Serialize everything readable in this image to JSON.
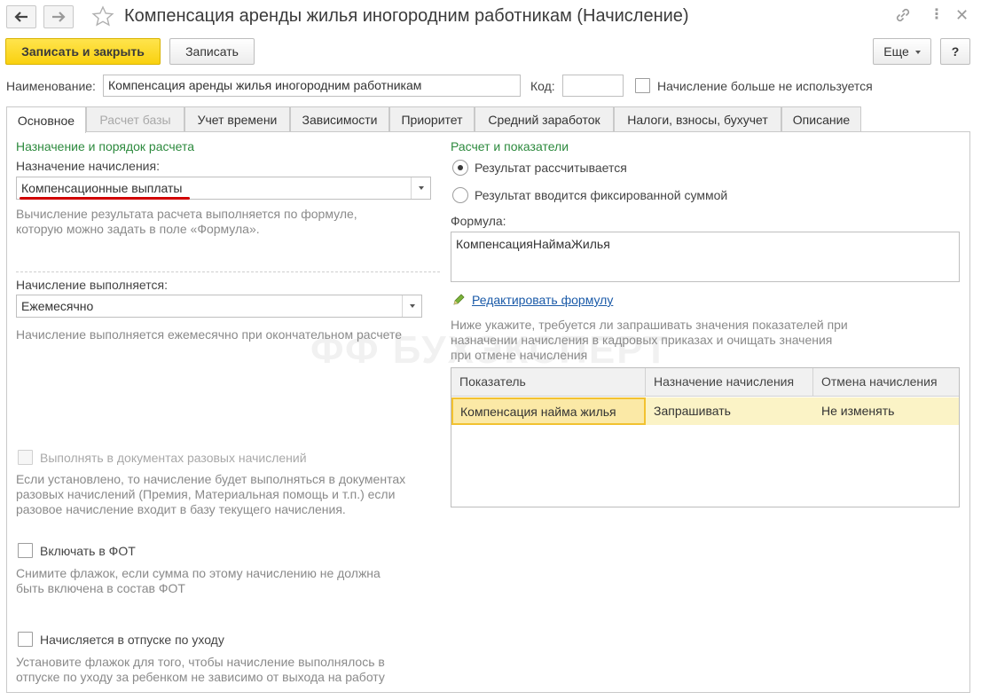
{
  "window": {
    "title": "Компенсация аренды жилья иногородним работникам (Начисление)"
  },
  "toolbar": {
    "save_close": "Записать и закрыть",
    "save": "Записать",
    "more": "Еще",
    "help": "?"
  },
  "header": {
    "name_label": "Наименование:",
    "name_value": "Компенсация аренды жилья иногородним работникам",
    "code_label": "Код:",
    "code_value": "",
    "unused_label": "Начисление больше не используется"
  },
  "tabs": [
    {
      "label": "Основное",
      "active": true
    },
    {
      "label": "Расчет базы",
      "disabled": true
    },
    {
      "label": "Учет времени"
    },
    {
      "label": "Зависимости"
    },
    {
      "label": "Приоритет"
    },
    {
      "label": "Средний заработок"
    },
    {
      "label": "Налоги, взносы, бухучет"
    },
    {
      "label": "Описание"
    }
  ],
  "left": {
    "section_title": "Назначение и порядок расчета",
    "purpose_label": "Назначение начисления:",
    "purpose_value": "Компенсационные выплаты",
    "purpose_hint": "Вычисление результата расчета выполняется по формуле, которую можно задать в поле «Формула».",
    "schedule_label": "Начисление выполняется:",
    "schedule_value": "Ежемесячно",
    "schedule_hint": "Начисление выполняется ежемесячно при окончательном расчете",
    "onetime_label": "Выполнять в документах разовых начислений",
    "onetime_hint": "Если установлено, то начисление будет выполняться в документах разовых начислений (Премия, Материальная помощь и т.п.) если разовое начисление входит в базу текущего начисления.",
    "fot_label": "Включать в ФОТ",
    "fot_hint": "Снимите флажок, если сумма по этому начислению не должна быть включена в состав ФОТ",
    "leave_label": "Начисляется в отпуске по уходу",
    "leave_hint": "Установите флажок для того, чтобы начисление выполнялось в отпуске по уходу за ребенком не зависимо от выхода на работу"
  },
  "right": {
    "section_title": "Расчет и показатели",
    "radio_calc": "Результат рассчитывается",
    "radio_fixed": "Результат вводится фиксированной суммой",
    "formula_label": "Формула:",
    "formula_value": "КомпенсацияНаймаЖилья",
    "edit_formula": "Редактировать формулу",
    "indicators_hint": "Ниже укажите, требуется ли запрашивать значения показателей при назначении начисления в кадровых приказах и очищать значения при отмене начисления",
    "table": {
      "headers": [
        "Показатель",
        "Назначение начисления",
        "Отмена начисления"
      ],
      "rows": [
        [
          "Компенсация найма жилья",
          "Запрашивать",
          "Не изменять"
        ]
      ]
    }
  },
  "watermark": "БУХЭКСПЕРТ",
  "colors": {
    "primary_button": "#f9d10f",
    "section_title": "#2d8a3e",
    "selected_row": "#fbf3c6",
    "selected_cell_border": "#f2c230",
    "underline_accent": "#d10000",
    "link": "#1a5aa8"
  }
}
